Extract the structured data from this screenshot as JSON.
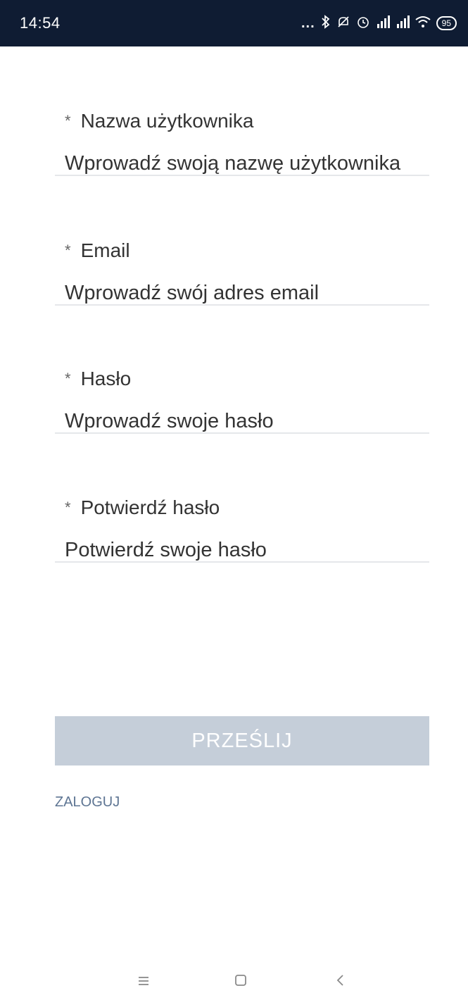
{
  "status_bar": {
    "time": "14:54",
    "dots": "...",
    "signal_1": "4G",
    "signal_2": "4G",
    "battery": "95"
  },
  "form": {
    "username": {
      "label": "Nazwa użytkownika",
      "placeholder": "Wprowadź swoją nazwę użytkownika",
      "value": ""
    },
    "email": {
      "label": "Email",
      "placeholder": "Wprowadź swój adres email",
      "value": ""
    },
    "password": {
      "label": "Hasło",
      "placeholder": "Wprowadź swoje hasło",
      "value": ""
    },
    "confirm_password": {
      "label": "Potwierdź hasło",
      "placeholder": "Potwierdź swoje hasło",
      "value": ""
    },
    "required_marker": "*",
    "submit_label": "PRZEŚLIJ",
    "login_link": "ZALOGUJ"
  },
  "colors": {
    "status_bar_bg": "#0f1c33",
    "button_disabled_bg": "#c5ced9",
    "link": "#5e7593",
    "divider": "#e5e7ea"
  },
  "nav": {
    "menu_icon": "menu-icon",
    "home_icon": "square-home-icon",
    "back_icon": "chevron-left-icon"
  }
}
